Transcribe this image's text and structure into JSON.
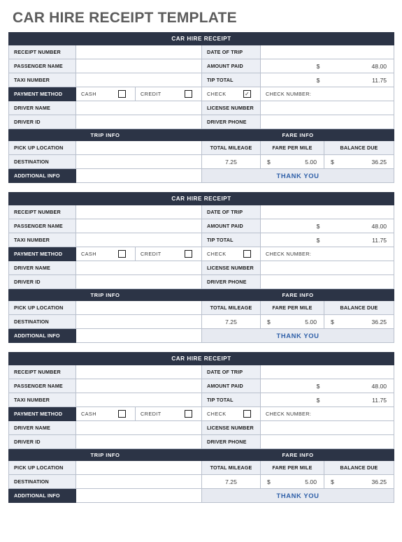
{
  "page": {
    "title": "CAR HIRE RECEIPT TEMPLATE"
  },
  "labels": {
    "header": "CAR HIRE RECEIPT",
    "receipt_number": "RECEIPT NUMBER",
    "passenger_name": "PASSENGER NAME",
    "taxi_number": "TAXI NUMBER",
    "payment_method": "PAYMENT METHOD",
    "driver_name": "DRIVER NAME",
    "driver_id": "DRIVER ID",
    "date_of_trip": "DATE OF TRIP",
    "amount_paid": "AMOUNT PAID",
    "tip_total": "TIP TOTAL",
    "license_number": "LICENSE NUMBER",
    "driver_phone": "DRIVER PHONE",
    "cash": "CASH",
    "credit": "CREDIT",
    "check": "CHECK",
    "check_number": "CHECK NUMBER:",
    "trip_info": "TRIP INFO",
    "fare_info": "FARE INFO",
    "pick_up_location": "PICK UP LOCATION",
    "destination": "DESTINATION",
    "additional_info": "ADDITIONAL INFO",
    "total_mileage": "TOTAL MILEAGE",
    "fare_per_mile": "FARE PER MILE",
    "balance_due": "BALANCE DUE",
    "thank_you": "THANK YOU",
    "currency": "$",
    "check_mark": "✓",
    "empty": ""
  },
  "colors": {
    "bar": "#2c3446",
    "label_bg": "#eceff5",
    "thanks_text": "#2e5fa8",
    "thanks_bg": "#e7eaf1",
    "title_text": "#5c5c5c",
    "border": "#b9c0cd"
  },
  "receipts": [
    {
      "id": "receipt-1",
      "receipt_number": "",
      "passenger_name": "",
      "taxi_number": "",
      "driver_name": "",
      "driver_id": "",
      "date_of_trip": "",
      "amount_paid": "48.00",
      "tip_total": "11.75",
      "license_number": "",
      "driver_phone": "",
      "check_number": "",
      "cash_checked": "",
      "credit_checked": "",
      "check_checked": "✓",
      "pick_up_location": "",
      "destination": "",
      "additional_info": "",
      "total_mileage": "7.25",
      "fare_per_mile": "5.00",
      "balance_due": "36.25",
      "thank_you": "THANK YOU"
    },
    {
      "id": "receipt-2",
      "receipt_number": "",
      "passenger_name": "",
      "taxi_number": "",
      "driver_name": "",
      "driver_id": "",
      "date_of_trip": "",
      "amount_paid": "48.00",
      "tip_total": "11.75",
      "license_number": "",
      "driver_phone": "",
      "check_number": "",
      "cash_checked": "",
      "credit_checked": "",
      "check_checked": "",
      "pick_up_location": "",
      "destination": "",
      "additional_info": "",
      "total_mileage": "7.25",
      "fare_per_mile": "5.00",
      "balance_due": "36.25",
      "thank_you": "THANK YOU"
    },
    {
      "id": "receipt-3",
      "receipt_number": "",
      "passenger_name": "",
      "taxi_number": "",
      "driver_name": "",
      "driver_id": "",
      "date_of_trip": "",
      "amount_paid": "48.00",
      "tip_total": "11.75",
      "license_number": "",
      "driver_phone": "",
      "check_number": "",
      "cash_checked": "",
      "credit_checked": "",
      "check_checked": "",
      "pick_up_location": "",
      "destination": "",
      "additional_info": "",
      "total_mileage": "7.25",
      "fare_per_mile": "5.00",
      "balance_due": "36.25",
      "thank_you": "THANK YOU"
    }
  ]
}
